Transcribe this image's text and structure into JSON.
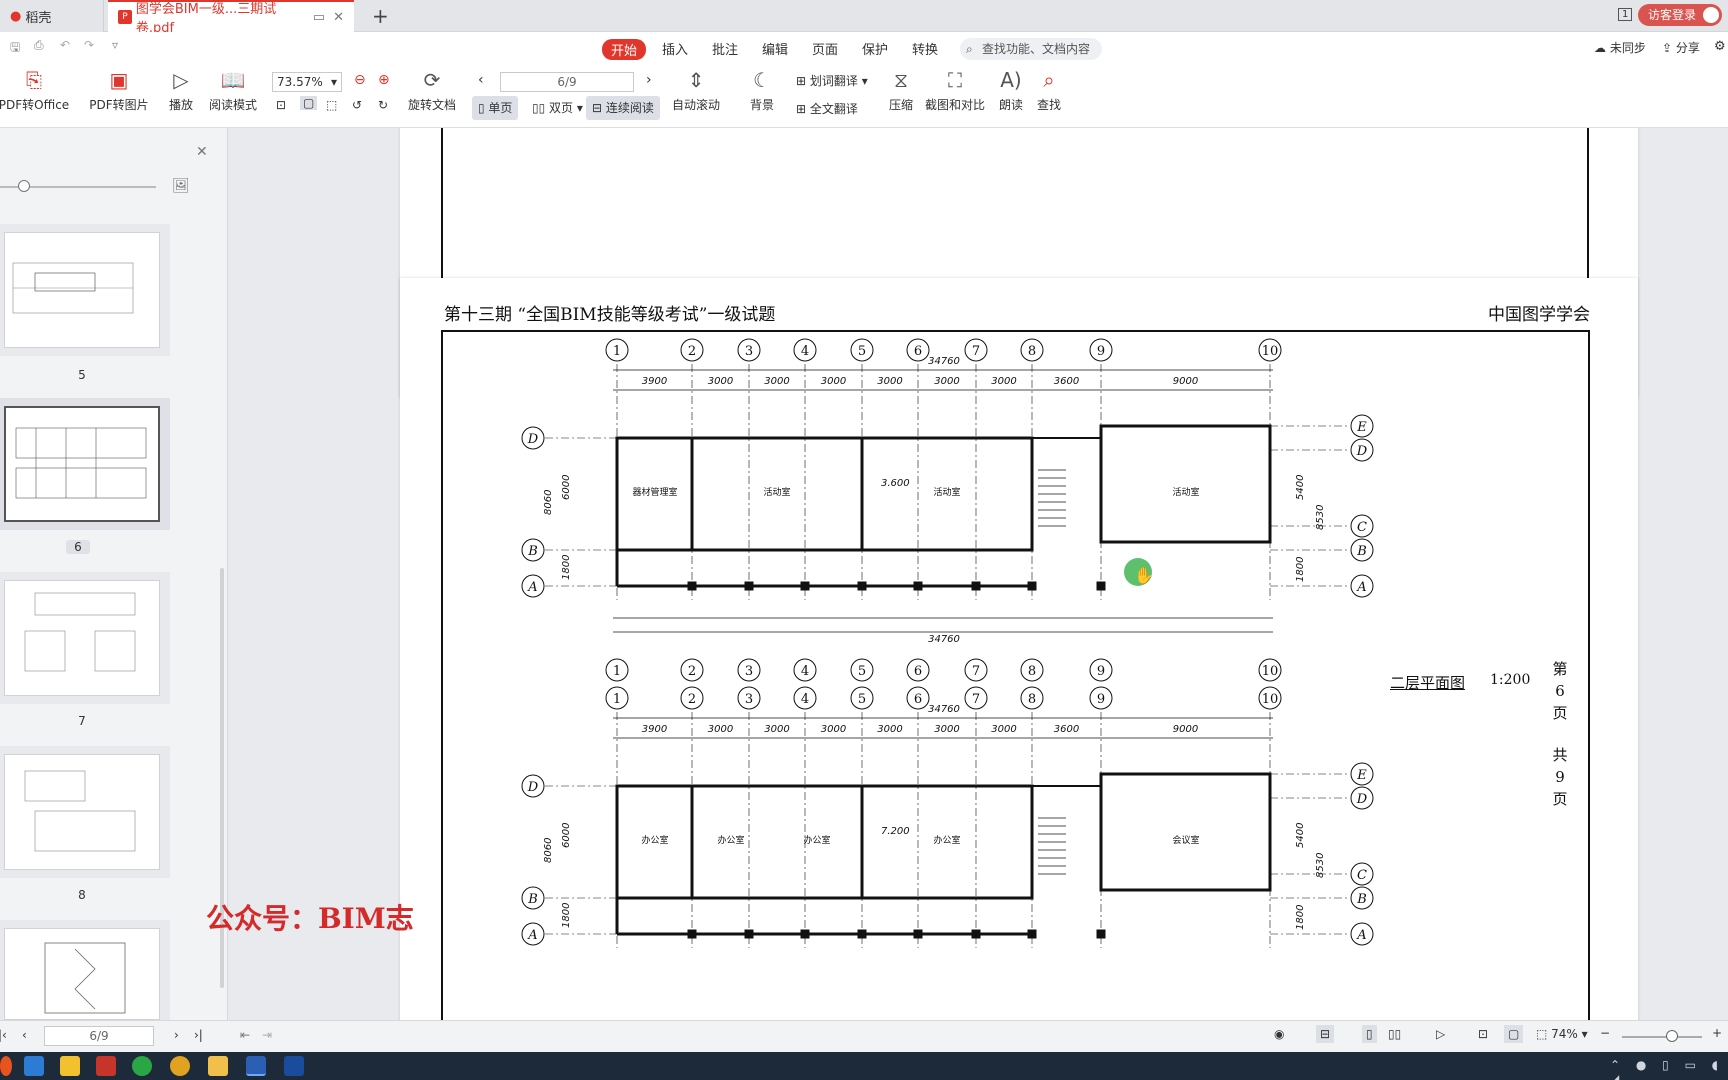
{
  "tabs": {
    "home_label": "稻壳",
    "pdf_label": "图学会BIM一级...三期试卷.pdf",
    "visitor_label": "访客登录",
    "badge": "1"
  },
  "menu": {
    "items": [
      "开始",
      "插入",
      "批注",
      "编辑",
      "页面",
      "保护",
      "转换"
    ],
    "search_placeholder": "查找功能、文档内容",
    "sync_label": "未同步",
    "share_label": "分享"
  },
  "toolbar": {
    "pdf_to_office": "PDF转Office",
    "pdf_to_image": "PDF转图片",
    "play": "播放",
    "read_mode": "阅读模式",
    "zoom": "73.57%",
    "rotate_doc": "旋转文档",
    "page_value": "6/9",
    "single_page": "单页",
    "double_page": "双页",
    "continuous": "连续阅读",
    "auto_scroll": "自动滚动",
    "background": "背景",
    "word_translate": "划词翻译",
    "full_translate": "全文翻译",
    "compress": "压缩",
    "screenshot_compare": "截图和对比",
    "read_aloud": "朗读",
    "find": "查找"
  },
  "sidebar": {
    "pages": [
      "5",
      "6",
      "7",
      "8"
    ]
  },
  "document": {
    "header_left": "第十三期 “全国BIM技能等级考试”一级试题",
    "header_right": "中国图学学会",
    "plan_title": "二层平面图",
    "plan_scale": "1:200",
    "page_side": [
      "第",
      "6",
      "页",
      "共",
      "9",
      "页"
    ],
    "total_dim": "34760",
    "top_axes": [
      "1",
      "2",
      "3",
      "4",
      "5",
      "6",
      "7",
      "8",
      "9",
      "10"
    ],
    "row_axes": [
      "D",
      "B",
      "A"
    ],
    "right_axes": [
      "E",
      "D",
      "C",
      "B",
      "A"
    ],
    "bay_dims": [
      "3900",
      "3000",
      "3000",
      "3000",
      "3000",
      "3000",
      "3000",
      "3600",
      "9000"
    ],
    "rooms_upper": [
      "器材管理室",
      "活动室",
      "活动室",
      "活动室"
    ],
    "rooms_lower": [
      "办公室",
      "办公室",
      "办公室",
      "办公室",
      "会议室"
    ],
    "level_upper": "3.600",
    "level_lower": "7.200",
    "left_dims": [
      "8060",
      "6000",
      "1800"
    ],
    "right_dims": [
      "8530",
      "5400",
      "1800"
    ]
  },
  "watermark": "公众号：BIM志",
  "status": {
    "page_value": "6/9",
    "zoom": "74%"
  }
}
